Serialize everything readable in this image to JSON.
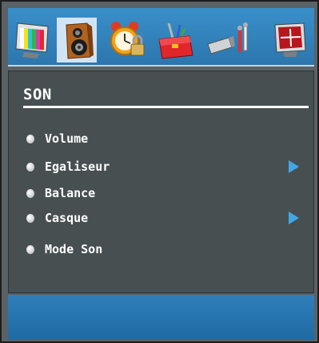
{
  "menu": {
    "title": "SON",
    "items": [
      {
        "label": "Volume",
        "has_submenu": false
      },
      {
        "label": "Egaliseur",
        "has_submenu": true
      },
      {
        "label": "Balance",
        "has_submenu": false
      },
      {
        "label": "Casque",
        "has_submenu": true
      },
      {
        "label": "Mode Son",
        "has_submenu": false
      }
    ]
  },
  "tabs": [
    {
      "icon": "picture-tv-icon",
      "selected": false
    },
    {
      "icon": "speaker-icon",
      "selected": true
    },
    {
      "icon": "alarm-clock-lock-icon",
      "selected": false
    },
    {
      "icon": "toolbox-icon",
      "selected": false
    },
    {
      "icon": "connectors-icon",
      "selected": false
    },
    {
      "icon": "source-monitor-icon",
      "selected": false
    }
  ],
  "colors": {
    "accent": "#2c76ad",
    "selected_tab": "#d2e4f4",
    "panel": "#474f51",
    "arrow": "#41a7e4"
  }
}
